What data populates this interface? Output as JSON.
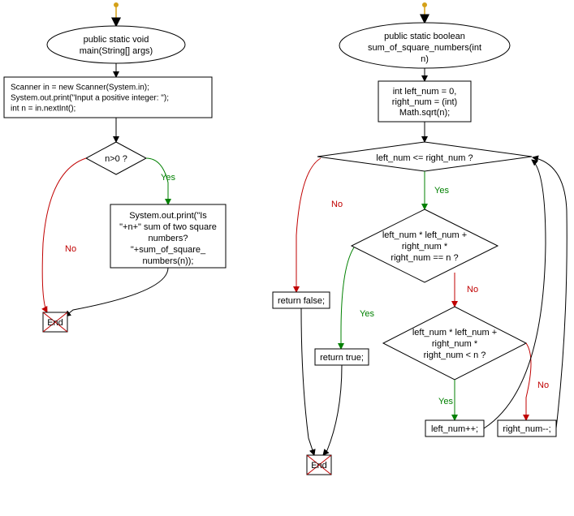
{
  "chart_data": {
    "type": "flowchart",
    "title": "",
    "functions": [
      {
        "name": "main",
        "start": "public static void main(String[] args)",
        "process": "Scanner in = new Scanner(System.in);\nSystem.out.print(\"Input a positive integer: \");\nint n = in.nextInt();",
        "decision": "n>0 ?",
        "yes_action": "System.out.print(\"Is \"+n+\" sum of two square numbers? \"+sum_of_square_numbers(n));",
        "end": "End"
      },
      {
        "name": "sum_of_square_numbers",
        "start": "public static boolean sum_of_square_numbers(int n)",
        "init": "int left_num = 0, right_num = (int) Math.sqrt(n);",
        "loop_cond": "left_num <= right_num ?",
        "loop_no": "return false;",
        "inner_cond1": "left_num * left_num + right_num * right_num == n ?",
        "inner1_yes": "return true;",
        "inner_cond2": "left_num * left_num + right_num * right_num < n ?",
        "inner2_yes": "left_num++;",
        "inner2_no": "right_num--;",
        "end": "End"
      }
    ]
  },
  "labels": {
    "yes": "Yes",
    "no": "No"
  },
  "left": {
    "start_l1": "public static void",
    "start_l2": "main(String[] args)",
    "proc_l1": "Scanner in = new Scanner(System.in);",
    "proc_l2": "System.out.print(\"Input a positive integer: \");",
    "proc_l3": "int n = in.nextInt();",
    "dec": "n>0 ?",
    "act_l1": "System.out.print(\"Is",
    "act_l2": "\"+n+\" sum of two square",
    "act_l3": "numbers?",
    "act_l4": "\"+sum_of_square_",
    "act_l5": "numbers(n));",
    "end": "End"
  },
  "right": {
    "start_l1": "public static boolean",
    "start_l2": "sum_of_square_numbers(int",
    "start_l3": "n)",
    "init_l1": "int left_num = 0,",
    "init_l2": "right_num = (int)",
    "init_l3": "Math.sqrt(n);",
    "loop": "left_num <= right_num ?",
    "ret_false": "return false;",
    "c1_l1": "left_num * left_num +",
    "c1_l2": "right_num *",
    "c1_l3": "right_num == n ?",
    "ret_true": "return true;",
    "c2_l1": "left_num * left_num +",
    "c2_l2": "right_num *",
    "c2_l3": "right_num < n ?",
    "inc": "left_num++;",
    "dec": "right_num--;",
    "end": "End"
  }
}
